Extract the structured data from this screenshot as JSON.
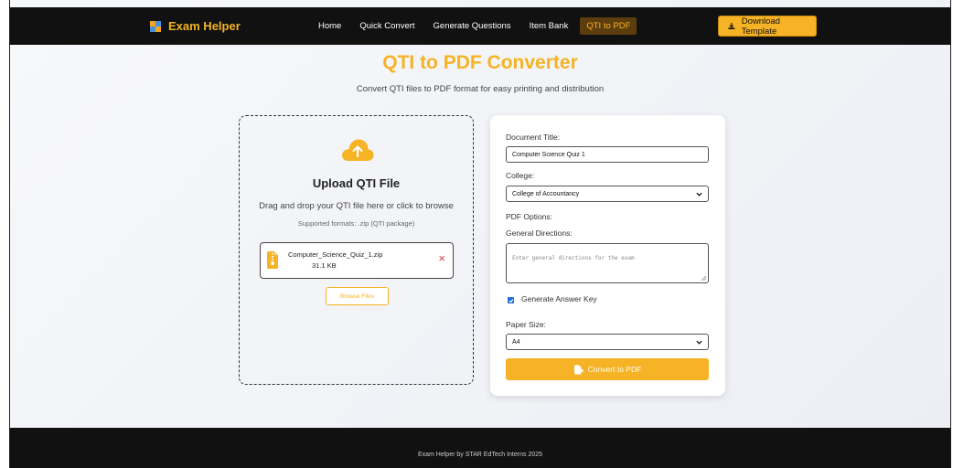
{
  "navbar": {
    "brand": "Exam Helper",
    "links": [
      "Home",
      "Quick Convert",
      "Generate Questions",
      "Item Bank",
      "QTI to PDF"
    ],
    "active_index": 4,
    "download_label": "Download Template"
  },
  "header": {
    "title": "QTI to PDF Converter",
    "subtitle": "Convert QTI files to PDF format for easy printing and distribution"
  },
  "upload": {
    "title": "Upload QTI File",
    "description": "Drag and drop your QTI file here or click to browse",
    "formats": "Supported formats: .zip (QTI package)",
    "file": {
      "name": "Computer_Science_Quiz_1.zip",
      "size": "31.1 KB"
    },
    "remove_icon": "×",
    "browse_label": "Browse Files"
  },
  "form": {
    "doc_title_label": "Document Title:",
    "doc_title_value": "Computer Science Quiz 1",
    "college_label": "College:",
    "college_value": "College of Accountancy",
    "pdf_options_label": "PDF Options:",
    "directions_label": "General Directions:",
    "directions_placeholder": "Enter general directions for the exam",
    "answer_key_label": "Generate Answer Key",
    "answer_key_checked": true,
    "paper_size_label": "Paper Size:",
    "paper_size_value": "A4",
    "convert_label": "Convert to PDF"
  },
  "footer": {
    "text": "Exam Helper by STAR EdTech Interns 2025"
  },
  "colors": {
    "accent": "#f5b325",
    "navbar_bg": "#111111",
    "danger": "#d93a3a",
    "checkbox": "#1a6fd6"
  }
}
